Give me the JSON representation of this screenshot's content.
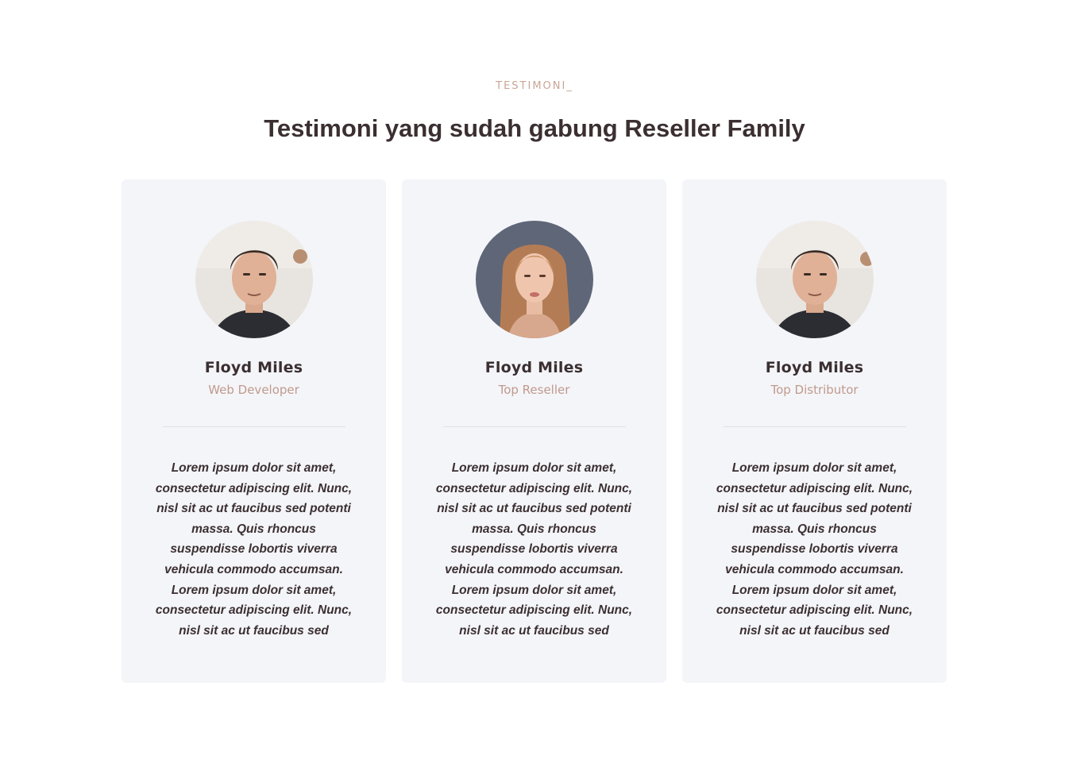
{
  "section": {
    "eyebrow": "TESTIMONI_",
    "title": "Testimoni yang sudah gabung Reseller Family"
  },
  "testimonials": [
    {
      "avatar_icon": "man-portrait",
      "name": "Floyd Miles",
      "role": "Web Developer",
      "quote": "Lorem ipsum dolor sit amet, consectetur adipiscing elit. Nunc, nisl sit ac ut faucibus sed potenti massa. Quis rhoncus suspendisse lobortis viverra vehicula commodo accumsan. Lorem ipsum dolor sit amet, consectetur adipiscing elit. Nunc, nisl sit ac ut faucibus sed"
    },
    {
      "avatar_icon": "woman-portrait",
      "name": "Floyd Miles",
      "role": "Top Reseller",
      "quote": "Lorem ipsum dolor sit amet, consectetur adipiscing elit. Nunc, nisl sit ac ut faucibus sed potenti massa. Quis rhoncus suspendisse lobortis viverra vehicula commodo accumsan. Lorem ipsum dolor sit amet, consectetur adipiscing elit. Nunc, nisl sit ac ut faucibus sed"
    },
    {
      "avatar_icon": "man-portrait",
      "name": "Floyd Miles",
      "role": "Top Distributor",
      "quote": "Lorem ipsum dolor sit amet, consectetur adipiscing elit. Nunc, nisl sit ac ut faucibus sed potenti massa. Quis rhoncus suspendisse lobortis viverra vehicula commodo accumsan. Lorem ipsum dolor sit amet, consectetur adipiscing elit. Nunc, nisl sit ac ut faucibus sed"
    }
  ],
  "colors": {
    "heading": "#3b2f31",
    "accent": "#c09a8c",
    "card_bg": "#f4f5f9"
  }
}
